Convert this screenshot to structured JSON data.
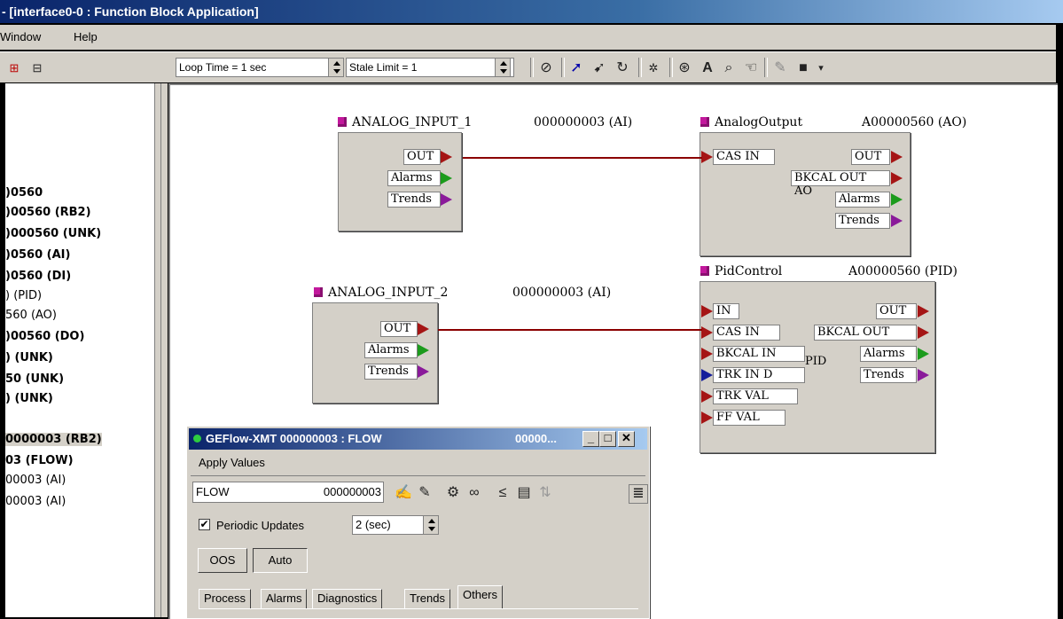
{
  "window": {
    "title": " - [interface0-0 : Function Block Application]"
  },
  "menubar": {
    "items": [
      "Window",
      "Help"
    ]
  },
  "toolbar": {
    "loop_time": "Loop Time = 1 sec",
    "stale_limit": "Stale Limit = 1"
  },
  "tree": {
    "items": [
      {
        "text": ")0560",
        "bold": true
      },
      {
        "text": ")00560 (RB2)",
        "bold": true
      },
      {
        "text": ")000560 (UNK)",
        "bold": true
      },
      {
        "text": ")0560 (AI)",
        "bold": true
      },
      {
        "text": ")0560 (DI)",
        "bold": true
      },
      {
        "text": ") (PID)",
        "bold": false
      },
      {
        "text": "560 (AO)",
        "bold": false
      },
      {
        "text": ")00560 (DO)",
        "bold": true
      },
      {
        "text": ") (UNK)",
        "bold": true
      },
      {
        "text": "50 (UNK)",
        "bold": true
      },
      {
        "text": ") (UNK)",
        "bold": true
      },
      {
        "text": "0000003 (RB2)",
        "bold": true
      },
      {
        "text": "03 (FLOW)",
        "bold": true
      },
      {
        "text": "00003 (AI)",
        "bold": false
      },
      {
        "text": "00003 (AI)",
        "bold": false
      }
    ]
  },
  "blocks": {
    "ai1": {
      "name": "ANALOG_INPUT_1",
      "id": "000000003 (AI)",
      "ports": [
        "OUT",
        "Alarms",
        "Trends"
      ]
    },
    "ai2": {
      "name": "ANALOG_INPUT_2",
      "id": "000000003 (AI)",
      "ports": [
        "OUT",
        "Alarms",
        "Trends"
      ]
    },
    "ao": {
      "name": "AnalogOutput",
      "id": "A00000560 (AO)",
      "inputs": [
        "CAS IN"
      ],
      "outputs": [
        "OUT",
        "BKCAL OUT",
        "Alarms",
        "Trends"
      ],
      "label": "AO"
    },
    "pid": {
      "name": "PidControl",
      "id": "A00000560 (PID)",
      "inputs": [
        "IN",
        "CAS IN",
        "BKCAL IN",
        "TRK IN D",
        "TRK VAL",
        "FF VAL"
      ],
      "outputs": [
        "OUT",
        "BKCAL OUT",
        "Alarms",
        "Trends"
      ],
      "label": "PID"
    }
  },
  "dialog": {
    "title": "GEFlow-XMT  000000003 : FLOW",
    "title_right": "00000...",
    "menu": "Apply Values",
    "block_name": "FLOW",
    "block_id": "000000003",
    "periodic_label": "Periodic Updates",
    "periodic_checked": true,
    "interval": "2 (sec)",
    "mode_buttons": [
      "OOS",
      "Auto"
    ],
    "tabs": [
      "Process",
      "Alarms",
      "Diagnostics",
      "Trends",
      "Others"
    ],
    "active_tab": "Others"
  },
  "colors": {
    "wire": "#8b0000",
    "title_blue": "#0a246a"
  }
}
